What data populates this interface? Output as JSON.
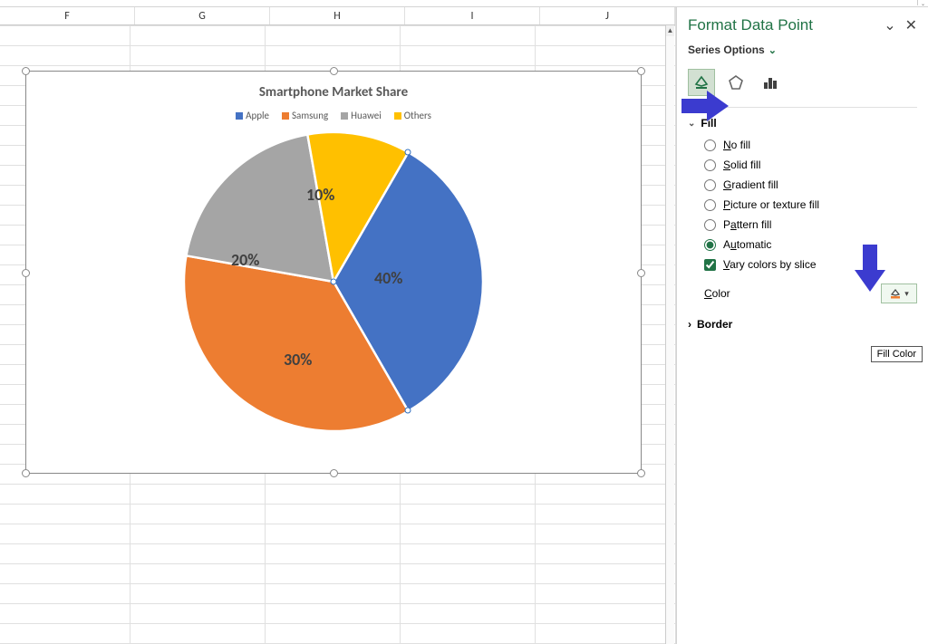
{
  "chart_data": {
    "type": "pie",
    "title": "Smartphone Market Share",
    "series_name": "Market Share",
    "categories": [
      "Apple",
      "Samsung",
      "Huawei",
      "Others"
    ],
    "values": [
      40,
      30,
      20,
      10
    ],
    "labels": [
      "40%",
      "30%",
      "20%",
      "10%"
    ],
    "colors": [
      "#4472C4",
      "#ED7D31",
      "#A5A5A5",
      "#FFC000"
    ],
    "data_labels": true,
    "legend_position": "top"
  },
  "columns": [
    "F",
    "G",
    "H",
    "I",
    "J"
  ],
  "pane": {
    "title": "Format Data Point",
    "series_options": "Series Options",
    "sections": {
      "fill": "Fill",
      "border": "Border"
    },
    "fill_options": {
      "no_fill": "No fill",
      "solid_fill": "Solid fill",
      "gradient_fill": "Gradient fill",
      "picture_fill": "Picture or texture fill",
      "pattern_fill": "Pattern fill",
      "automatic": "Automatic"
    },
    "vary_colors": "Vary colors by slice",
    "color_label": "Color",
    "tooltip": "Fill Color",
    "icons": {
      "fill": "paint-bucket-icon",
      "effects": "pentagon-icon",
      "chart": "bar-chart-icon"
    }
  }
}
